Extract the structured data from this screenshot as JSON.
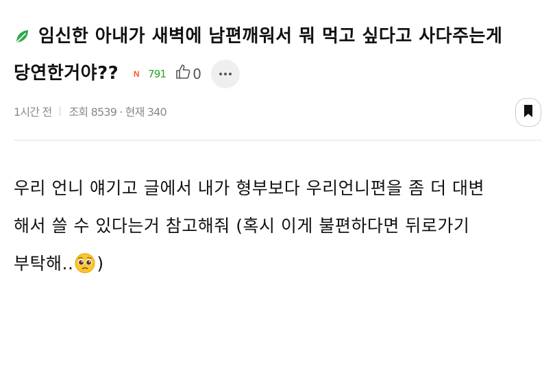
{
  "post": {
    "title_line1": "임신한 아내가 새벽에 남편깨워서 뭐 먹고 싶다고 사다주는게",
    "title_line2": "당연한거야??",
    "new_badge": "N",
    "views_inline": "791",
    "likes": "0",
    "time": "1시간 전",
    "hits_label": "조회 8539",
    "current_label": "· 현재 340"
  },
  "content": {
    "line1": "우리 언니 얘기고 글에서 내가 형부보다 우리언니편을 좀 더 대변",
    "line2": "해서 쓸 수 있다는거 참고해줘 (혹시 이게 불편하다면 뒤로가기",
    "line3_text": "부탁해..",
    "line3_close": ")"
  },
  "icons": {
    "leaf": "leaf-icon",
    "like": "thumbs-up-icon",
    "more": "more-dots-icon",
    "bookmark": "bookmark-icon",
    "emoji": "pleading-face-emoji"
  },
  "colors": {
    "leaf": "#2fa84f",
    "new_badge": "#ff5a1f",
    "views": "#27a32b",
    "meta": "#888888",
    "divider": "#e2e2e2"
  }
}
